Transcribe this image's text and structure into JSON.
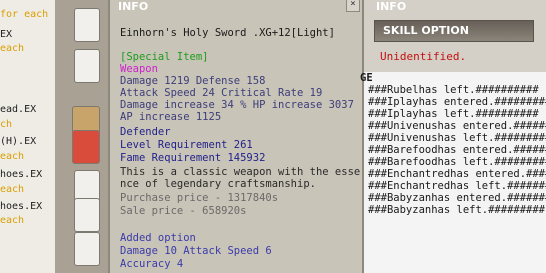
{
  "inventory": {
    "rows": [
      {
        "text": "for each",
        "color": "orange"
      },
      {
        "text": "EX",
        "color": "dark"
      },
      {
        "text": "each",
        "color": "orange"
      },
      {
        "text": "ead.EX",
        "color": "dark"
      },
      {
        "text": "ch",
        "color": "orange"
      },
      {
        "text": "(H).EX",
        "color": "dark"
      },
      {
        "text": "each",
        "color": "orange"
      },
      {
        "text": "hoes.EX",
        "color": "dark"
      },
      {
        "text": "each",
        "color": "orange"
      },
      {
        "text": "hoes.EX",
        "color": "dark"
      },
      {
        "text": "each",
        "color": "orange"
      }
    ]
  },
  "info_panel": {
    "title": "INFO",
    "item_name": "Einhorn's Holy Sword .XG+12[Light]",
    "special": "[Special Item]",
    "category": "Weapon",
    "stats": [
      {
        "text": "Damage 1219      Defense 158",
        "color": "c-slate"
      },
      {
        "text": "Attack Speed 24    Critical Rate 19",
        "color": "c-slate"
      },
      {
        "text": "Damage increase 34 %    HP increase 3037",
        "color": "c-slate"
      },
      {
        "text": "AP increase 1125",
        "color": "c-slate"
      },
      {
        "text": "Defender",
        "color": "c-navy"
      },
      {
        "text": "Level Requirement 261",
        "color": "c-navy"
      },
      {
        "text": "Fame Requirement 145932",
        "color": "c-navy"
      },
      {
        "text": "This is a classic weapon with the esse",
        "color": "c-dark"
      },
      {
        "text": "nce of legendary craftsmanship.",
        "color": "c-dark"
      },
      {
        "text": "Purchase price - 1317840s",
        "color": "c-gray"
      },
      {
        "text": "Sale price - 658920s",
        "color": "c-gray"
      }
    ],
    "added_header": "Added option",
    "added": [
      {
        "text": "Damage 10  Attack Speed 6",
        "color": "c-blue"
      },
      {
        "text": "Accuracy 4",
        "color": "c-blue"
      }
    ]
  },
  "right_panel": {
    "title": "INFO",
    "skill_option": "SKILL OPTION",
    "status": "Unidentified.",
    "chat_header": "GE",
    "chat": [
      "###Rubelhas left.##########",
      "###Iplayhas entered.#########",
      "###Iplayhas left.##########",
      "###Univenushas entered.######",
      "###Univenushas left.#########",
      "###Barefoodhas entered.######",
      "###Barefoodhas left.#########",
      "###Enchantredhas entered.#####",
      "###Enchantredhas left.########",
      "###Babyzanhas entered.#######",
      "###Babyzanhas left.#########"
    ]
  }
}
